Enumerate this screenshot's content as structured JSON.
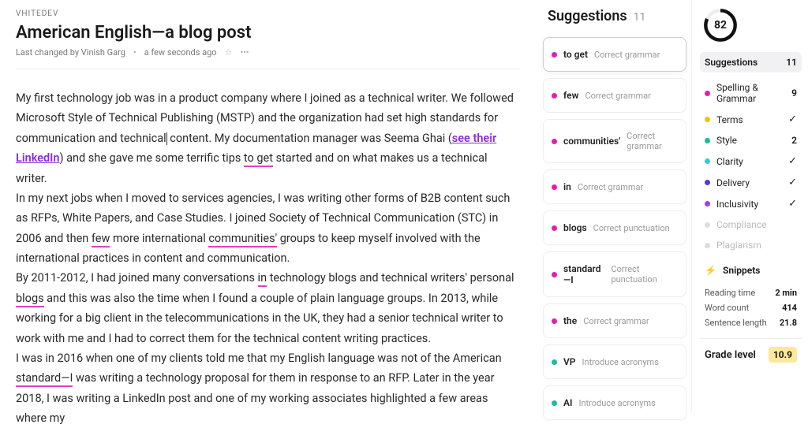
{
  "breadcrumb": "VHITEDEV",
  "title": "American English—a blog post",
  "meta": {
    "author_line": "Last changed by Vinish Garg",
    "time": "a few seconds ago"
  },
  "body": {
    "p1a": "My first technology job was in a product company where I joined as a technical writer. We followed Microsoft Style of Technical Publishing (MSTP) and the organization had set high standards for communication and technical",
    "p1b": "content. My documentation manager was Seema Ghai (",
    "link": "see their LinkedIn",
    "p1c": ") and she gave me some terrific tips ",
    "u_toget": "to get",
    "p1d": " started and on what makes us a technical writer.",
    "p2a": "In my next jobs when I moved to services agencies, I was writing other forms of B2B content such as RFPs, White Papers, and Case Studies. I joined Society of Technical Communication (STC) in 2006 and then ",
    "u_few": "few",
    "p2b": " more international ",
    "u_comm": "communities'",
    "p2c": " groups to keep myself involved with the international practices in content and communication.",
    "p3a": "By 2011-2012, I had joined many conversations ",
    "u_in": "in",
    "p3b": " technology blogs and technical writers' personal ",
    "u_blogs": "blogs",
    "p3c": " and this was also the time when I found a couple of plain language groups. In 2013, while working for a big client in the telecommunications in the UK, they had a senior technical writer to work with me and I had to correct them for the technical content writing practices.",
    "p4a": "I was in 2016 when one of my clients told me that my English language was not of the American ",
    "u_std": "standard—I",
    "p4b": " was writing a technology proposal for them in response to an RFP. Later in the year 2018, I was writing a LinkedIn post and one of my working associates highlighted a few areas where my"
  },
  "suggestions": {
    "heading": "Suggestions",
    "count": "11",
    "items": [
      {
        "term": "to get",
        "reason": "Correct grammar",
        "color": "magenta",
        "active": true
      },
      {
        "term": "few",
        "reason": "Correct grammar",
        "color": "magenta"
      },
      {
        "term": "communities'",
        "reason": "Correct grammar",
        "color": "magenta"
      },
      {
        "term": "in",
        "reason": "Correct grammar",
        "color": "magenta"
      },
      {
        "term": "blogs",
        "reason": "Correct punctuation",
        "color": "magenta"
      },
      {
        "term": "standard—I",
        "reason": "Correct punctuation",
        "color": "magenta"
      },
      {
        "term": "the",
        "reason": "Correct grammar",
        "color": "magenta"
      },
      {
        "term": "VP",
        "reason": "Introduce acronyms",
        "color": "teal"
      },
      {
        "term": "AI",
        "reason": "Introduce acronyms",
        "color": "teal"
      }
    ]
  },
  "sidebar": {
    "score": "82",
    "header_label": "Suggestions",
    "header_count": "11",
    "categories": [
      {
        "label": "Spelling & Grammar",
        "color": "#e61ead",
        "val": "9"
      },
      {
        "label": "Terms",
        "color": "#f1c40f",
        "check": true
      },
      {
        "label": "Style",
        "color": "#1abc9c",
        "val": "2"
      },
      {
        "label": "Clarity",
        "color": "#2ecce0",
        "check": true
      },
      {
        "label": "Delivery",
        "color": "#4a3fe3",
        "check": true
      },
      {
        "label": "Inclusivity",
        "color": "#a03fe3",
        "check": true
      },
      {
        "label": "Compliance",
        "color": "#ddd",
        "dim": true
      },
      {
        "label": "Plagiarism",
        "color": "#ddd",
        "dim": true
      }
    ],
    "snippets_label": "Snippets",
    "stats": [
      {
        "k": "Reading time",
        "v": "2 min"
      },
      {
        "k": "Word count",
        "v": "414"
      },
      {
        "k": "Sentence length",
        "v": "21.8"
      }
    ],
    "grade": {
      "k": "Grade level",
      "v": "10.9"
    }
  }
}
